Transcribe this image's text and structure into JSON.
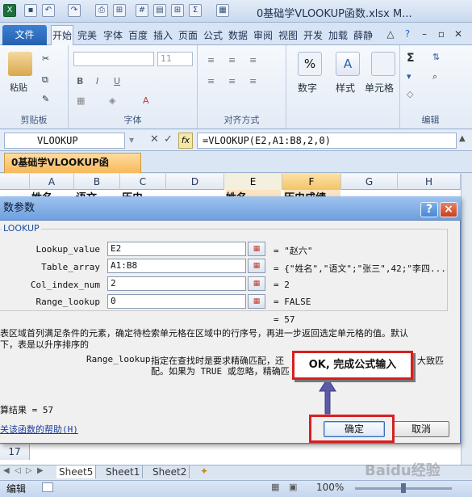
{
  "window": {
    "title": "0基础学VLOOKUP函数.xlsx M..."
  },
  "ribbon_tabs": [
    "文件",
    "开始",
    "插入",
    "页面",
    "公式",
    "数据",
    "审阅",
    "视图",
    "开发",
    "加载",
    "薛静"
  ],
  "ribbon_tabs_partial": [
    "完美",
    "字体",
    "百度"
  ],
  "ribbon": {
    "paste_label": "粘贴",
    "clipboard_group": "剪贴板",
    "font_group": "字体",
    "font_size": "11",
    "bold": "B",
    "italic": "I",
    "underline": "U",
    "align_group": "对齐方式",
    "number_label": "数字",
    "style_label": "样式",
    "cells_label": "单元格",
    "edit_group": "编辑",
    "percent": "%",
    "sigma": "Σ"
  },
  "formula_bar": {
    "name_box": "VLOOKUP",
    "fx": "fx",
    "formula": "=VLOOKUP(E2,A1:B8,2,0)"
  },
  "workbook_tab": "0基础学VLOOKUP函数.xlsx",
  "columns": [
    "A",
    "B",
    "C",
    "D",
    "E",
    "F",
    "G",
    "H"
  ],
  "row1": [
    "姓名",
    "语文",
    "历史",
    "",
    "姓名",
    "历史成绩"
  ],
  "row17": "17",
  "dialog": {
    "title": "数参数",
    "help_icon": "?",
    "close_icon": "×",
    "group_label": "LOOKUP",
    "args": [
      {
        "name": "Lookup_value",
        "value": "E2",
        "result": "= \"赵六\""
      },
      {
        "name": "Table_array",
        "value": "A1:B8",
        "result": "= {\"姓名\",\"语文\";\"张三\",42;\"李四..."
      },
      {
        "name": "Col_index_num",
        "value": "2",
        "result": "= 2"
      },
      {
        "name": "Range_lookup",
        "value": "0",
        "result": "= FALSE"
      }
    ],
    "total_result": "= 57",
    "description": "表区域首列满足条件的元素，确定待检索单元格在区域中的行序号，再进一步返回选定单元格的值。默认",
    "description2": "下，表是以升序排序的",
    "param_name": "Range_lookup",
    "param_desc": "指定在查找时是要求精确匹配，还",
    "param_desc_tail": "大致匹",
    "param_desc2": "配。如果为 TRUE 或忽略，精确匹",
    "calc_result": "算结果 = 57",
    "help_link": "关该函数的帮助(H)",
    "ok": "确定",
    "cancel": "取消"
  },
  "callout": "OK, 完成公式输入",
  "sheet_tabs": [
    "Sheet5",
    "Sheet1",
    "Sheet2"
  ],
  "status": {
    "mode": "编辑",
    "zoom": "100%"
  },
  "watermark": "Baidu经验",
  "colors": {
    "accent": "#2660b0",
    "highlight": "#f3c466",
    "callout_border": "#d62020"
  }
}
